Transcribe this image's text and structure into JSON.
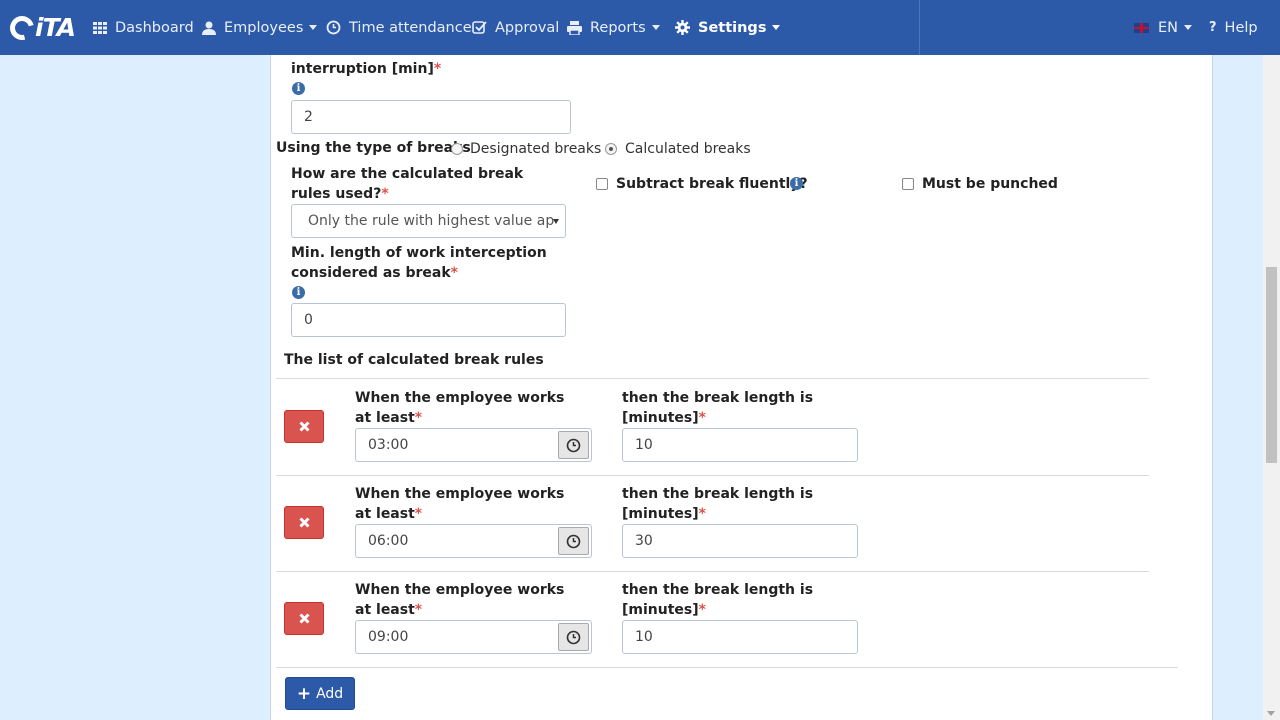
{
  "nav": {
    "logo_text": "iTA",
    "items": [
      {
        "label": "Dashboard",
        "icon": "grid-icon"
      },
      {
        "label": "Employees",
        "icon": "user-icon"
      },
      {
        "label": "Time attendance",
        "icon": "clock-icon"
      },
      {
        "label": "Approval",
        "icon": "check-square-icon"
      },
      {
        "label": "Reports",
        "icon": "printer-icon"
      },
      {
        "label": "Settings",
        "icon": "gear-icon"
      }
    ],
    "language": "EN",
    "help": "Help"
  },
  "form": {
    "interruption_label": "interruption [min]",
    "interruption_value": "2",
    "break_type_label": "Using the type of breaks",
    "break_type_options": [
      "Designated breaks",
      "Calculated breaks"
    ],
    "break_type_selected": "Calculated breaks",
    "rules_used_label": "How are the calculated break rules used?",
    "rules_used_value": "Only the rule with highest value ap",
    "subtract_fluently_label": "Subtract break fluently?",
    "must_be_punched_label": "Must be punched",
    "min_length_label": "Min. length of work interception considered as break",
    "min_length_value": "0",
    "list_title": "The list of calculated break rules",
    "rule_works_label": "When the employee works at least",
    "rule_break_label": "then the break length is [minutes]",
    "rules": [
      {
        "works_at_least": "03:00",
        "break_minutes": "10"
      },
      {
        "works_at_least": "06:00",
        "break_minutes": "30"
      },
      {
        "works_at_least": "09:00",
        "break_minutes": "10"
      }
    ],
    "add_label": "Add"
  },
  "colors": {
    "navbar": "#2c5aa8",
    "background": "#ddeeff",
    "danger": "#d9534f",
    "primary": "#2c5aa8"
  }
}
